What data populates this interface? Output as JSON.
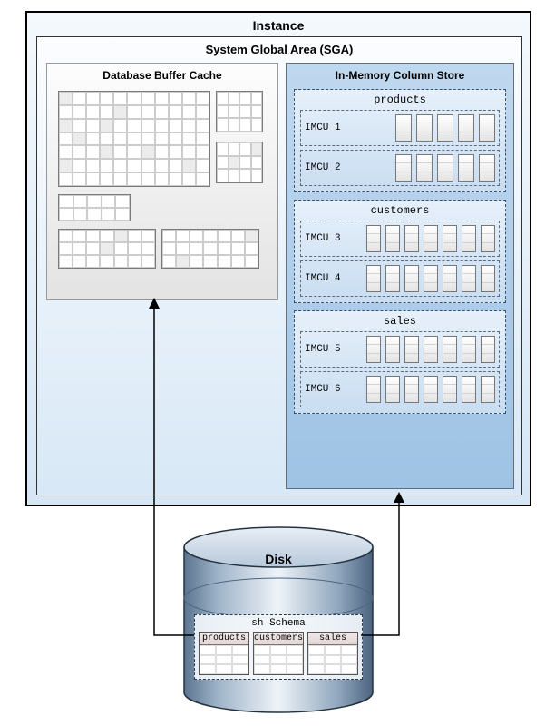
{
  "instance": {
    "title": "Instance"
  },
  "sga": {
    "title": "System Global Area (SGA)"
  },
  "buffer_cache": {
    "title": "Database Buffer Cache"
  },
  "im_store": {
    "title": "In-Memory Column Store",
    "tables": [
      {
        "name": "products",
        "imcus": [
          "IMCU 1",
          "IMCU 2"
        ],
        "cols": 5
      },
      {
        "name": "customers",
        "imcus": [
          "IMCU 3",
          "IMCU 4"
        ],
        "cols": 7
      },
      {
        "name": "sales",
        "imcus": [
          "IMCU 5",
          "IMCU 6"
        ],
        "cols": 7
      }
    ]
  },
  "disk": {
    "label": "Disk",
    "schema": {
      "name": "sh Schema",
      "tables": [
        "products",
        "customers",
        "sales"
      ]
    }
  }
}
